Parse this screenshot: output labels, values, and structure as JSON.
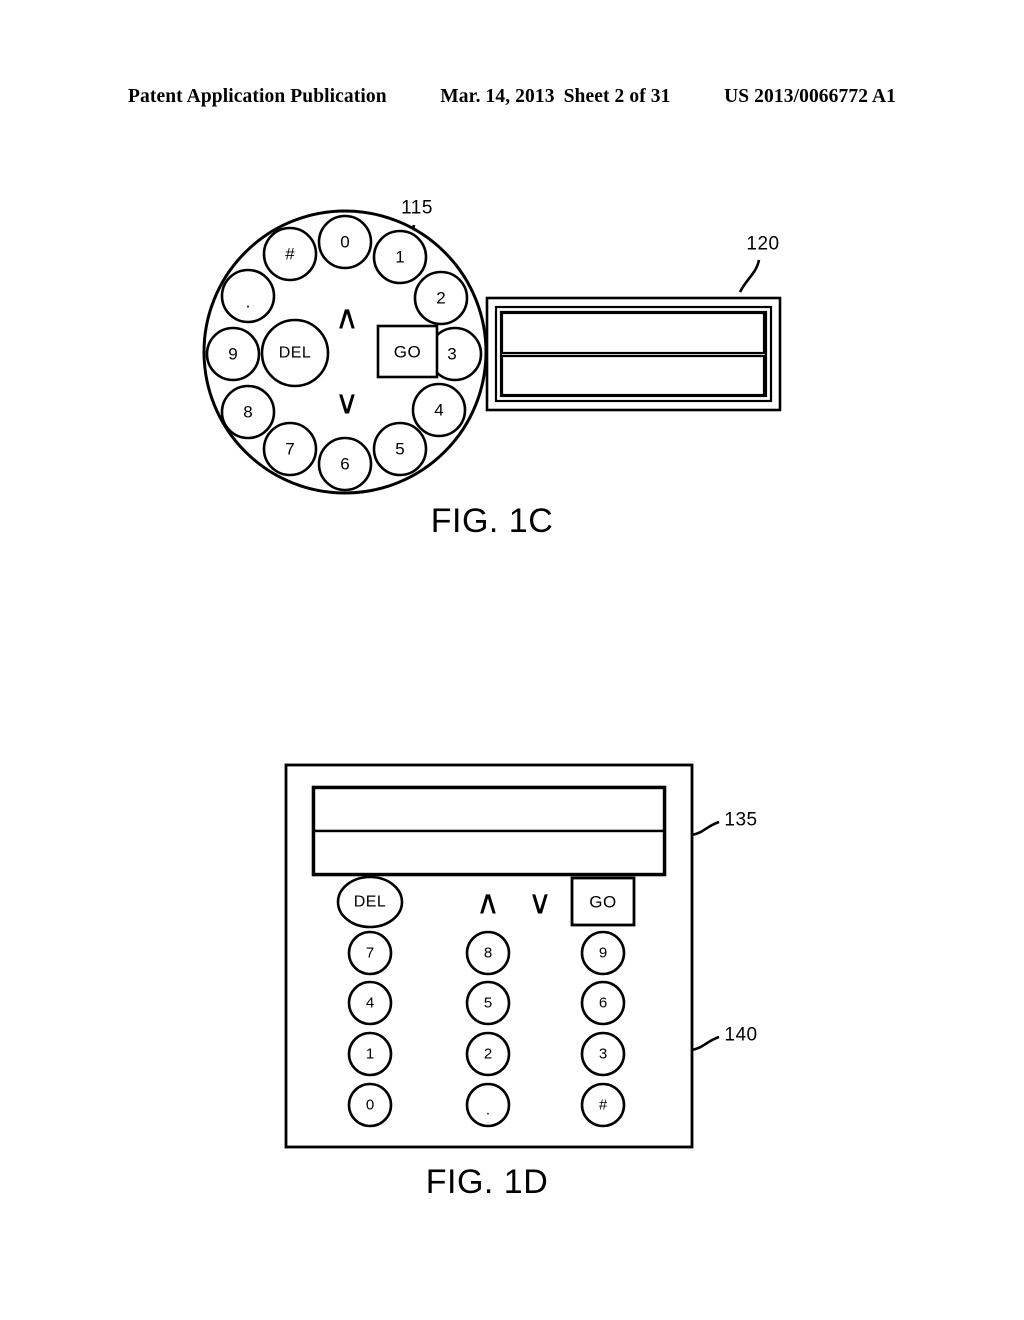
{
  "header": {
    "left": "Patent Application Publication",
    "date": "Mar. 14, 2013",
    "sheet": "Sheet 2 of 31",
    "publication_number": "US 2013/0066772 A1"
  },
  "figures": [
    {
      "id": "fig1c",
      "caption": "FIG. 1C",
      "reference_numerals": [
        {
          "id": "115",
          "label": "115",
          "target": "circular-keypad"
        },
        {
          "id": "120",
          "label": "120",
          "target": "display-panel"
        }
      ],
      "circular_keypad": {
        "name": "circular-keypad",
        "ring_keys": [
          {
            "label": "0",
            "angle_deg": -90
          },
          {
            "label": "1",
            "angle_deg": -60
          },
          {
            "label": "2",
            "angle_deg": -29
          },
          {
            "label": "3",
            "angle_deg": 1
          },
          {
            "label": "4",
            "angle_deg": 31
          },
          {
            "label": "5",
            "angle_deg": 60
          },
          {
            "label": "6",
            "angle_deg": 90
          },
          {
            "label": "7",
            "angle_deg": 120
          },
          {
            "label": "8",
            "angle_deg": 150
          },
          {
            "label": "9",
            "angle_deg": 180
          },
          {
            "label": ".",
            "angle_deg": -150
          },
          {
            "label": "#",
            "angle_deg": -120
          }
        ],
        "center_keys": [
          {
            "label": "DEL",
            "shape": "circle"
          },
          {
            "label": "GO",
            "shape": "rect"
          }
        ],
        "arrows": [
          {
            "label": "∧",
            "name": "scroll-up-arrow"
          },
          {
            "label": "∨",
            "name": "scroll-down-arrow"
          }
        ]
      },
      "display_panel": {
        "name": "display-panel",
        "rows": [
          "",
          ""
        ]
      }
    },
    {
      "id": "fig1d",
      "caption": "FIG. 1D",
      "reference_numerals": [
        {
          "id": "135",
          "label": "135",
          "target": "display-panel"
        },
        {
          "id": "140",
          "label": "140",
          "target": "device-body"
        }
      ],
      "display_panel": {
        "name": "display-panel",
        "rows": [
          "",
          ""
        ]
      },
      "keypad": {
        "name": "grid-keypad",
        "top_row": [
          {
            "label": "DEL",
            "shape": "ellipse",
            "name": "del-key"
          },
          {
            "label": "∧",
            "shape": "glyph",
            "name": "scroll-up-arrow"
          },
          {
            "label": "∨",
            "shape": "glyph",
            "name": "scroll-down-arrow"
          },
          {
            "label": "GO",
            "shape": "rect",
            "name": "go-key"
          }
        ],
        "grid_rows": [
          [
            "7",
            "8",
            "9"
          ],
          [
            "4",
            "5",
            "6"
          ],
          [
            "1",
            "2",
            "3"
          ],
          [
            "0",
            ".",
            "#"
          ]
        ]
      }
    }
  ],
  "colors": {
    "ink": "#000000",
    "paper": "#ffffff"
  }
}
